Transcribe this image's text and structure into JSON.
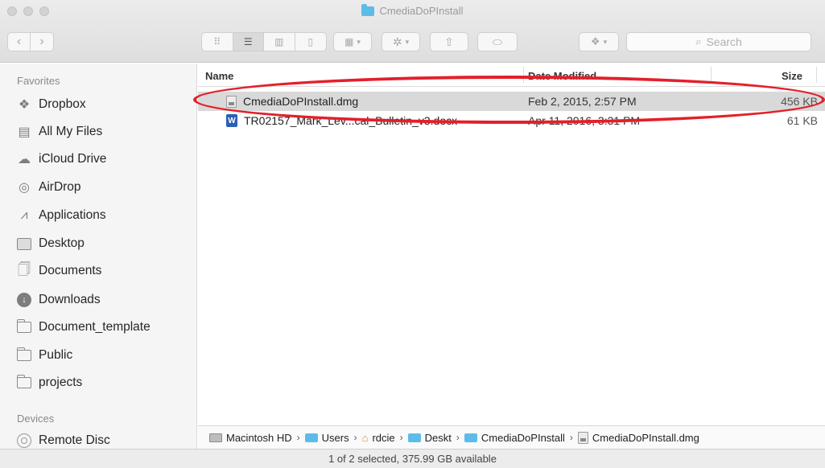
{
  "window": {
    "title": "CmediaDoPInstall"
  },
  "toolbar": {
    "search_placeholder": "Search",
    "share_glyph": "⇧",
    "tag_glyph": "⬭",
    "gear_glyph": "✲",
    "dropbox_glyph": "❖"
  },
  "sidebar": {
    "favorites_label": "Favorites",
    "favorites": [
      {
        "label": "Dropbox",
        "icon": "dropbox-icon"
      },
      {
        "label": "All My Files",
        "icon": "all-files-icon"
      },
      {
        "label": "iCloud Drive",
        "icon": "cloud-icon"
      },
      {
        "label": "AirDrop",
        "icon": "airdrop-icon"
      },
      {
        "label": "Applications",
        "icon": "applications-icon"
      },
      {
        "label": "Desktop",
        "icon": "desktop-icon"
      },
      {
        "label": "Documents",
        "icon": "documents-icon"
      },
      {
        "label": "Downloads",
        "icon": "downloads-icon"
      },
      {
        "label": "Document_template",
        "icon": "folder-icon"
      },
      {
        "label": "Public",
        "icon": "folder-icon"
      },
      {
        "label": "projects",
        "icon": "folder-icon"
      }
    ],
    "devices_label": "Devices",
    "devices": [
      {
        "label": "Remote Disc",
        "icon": "disc-icon"
      }
    ]
  },
  "list": {
    "columns": {
      "name": "Name",
      "date": "Date Modified",
      "size": "Size"
    },
    "files": [
      {
        "name": "CmediaDoPInstall.dmg",
        "date": "Feb 2, 2015, 2:57 PM",
        "size": "456 KB",
        "selected": true,
        "icon": "dmg-file-icon"
      },
      {
        "name": "TR02157_Mark_Lev...cal_Bulletin_v3.docx",
        "date": "Apr 11, 2016, 3:31 PM",
        "size": "61 KB",
        "selected": false,
        "icon": "word-file-icon"
      }
    ]
  },
  "pathbar": {
    "segments": [
      "Macintosh HD",
      "Users",
      "rdcie",
      "Deskt",
      "CmediaDoPInstall",
      "CmediaDoPInstall.dmg"
    ]
  },
  "status": {
    "text": "1 of 2 selected, 375.99 GB available"
  },
  "annotation": {
    "highlight_color": "#e3202a"
  }
}
